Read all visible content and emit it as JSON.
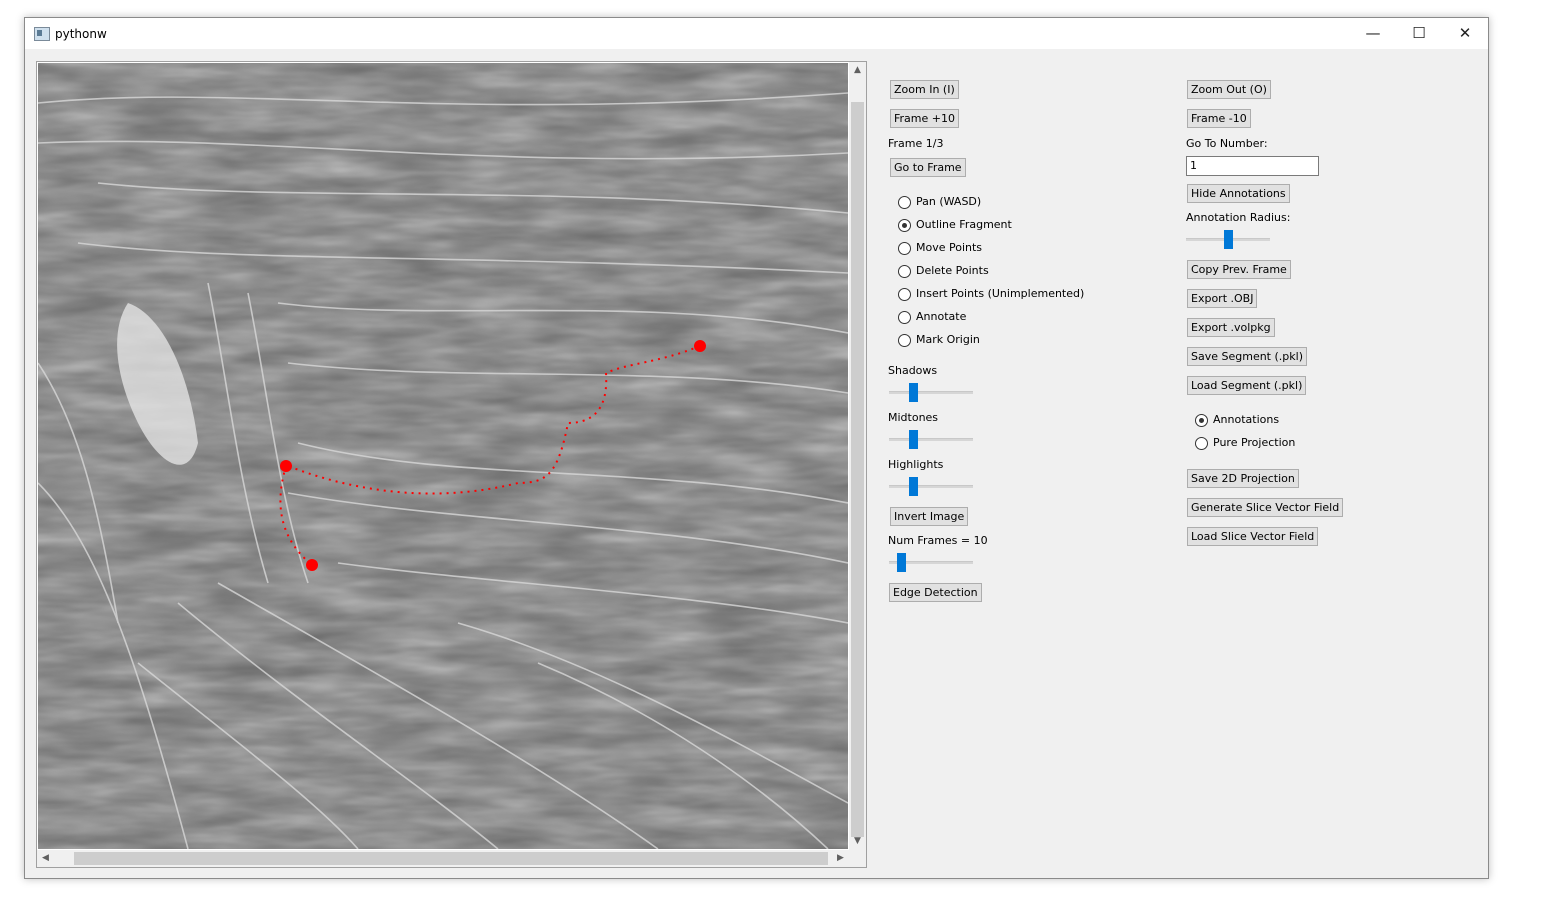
{
  "window": {
    "title": "pythonw"
  },
  "left": {
    "zoom_in": "Zoom In (I)",
    "frame_plus": "Frame +10",
    "frame_label": "Frame 1/3",
    "go_to_frame": "Go to Frame",
    "modes": [
      {
        "label": "Pan (WASD)",
        "checked": false
      },
      {
        "label": "Outline Fragment",
        "checked": true
      },
      {
        "label": "Move Points",
        "checked": false
      },
      {
        "label": "Delete Points",
        "checked": false
      },
      {
        "label": "Insert Points (Unimplemented)",
        "checked": false
      },
      {
        "label": "Annotate",
        "checked": false
      },
      {
        "label": "Mark Origin",
        "checked": false
      }
    ],
    "shadows_label": "Shadows",
    "shadows_value": 0.27,
    "midtones_label": "Midtones",
    "midtones_value": 0.27,
    "highlights_label": "Highlights",
    "highlights_value": 0.27,
    "invert_image": "Invert Image",
    "num_frames_label": "Num Frames = 10",
    "num_frames_value": 0.1,
    "edge_detection": "Edge Detection"
  },
  "right": {
    "zoom_out": "Zoom Out (O)",
    "frame_minus": "Frame -10",
    "go_to_number_label": "Go To Number:",
    "go_to_number_value": "1",
    "hide_annotations": "Hide Annotations",
    "annotation_radius_label": "Annotation Radius:",
    "annotation_radius_value": 0.5,
    "copy_prev_frame": "Copy Prev. Frame",
    "export_obj": "Export .OBJ",
    "export_volpkg": "Export .volpkg",
    "save_segment": "Save Segment (.pkl)",
    "load_segment": "Load Segment (.pkl)",
    "views": [
      {
        "label": "Annotations",
        "checked": true
      },
      {
        "label": "Pure Projection",
        "checked": false
      }
    ],
    "save_2d_projection": "Save 2D Projection",
    "generate_slice_vector_field": "Generate Slice Vector Field",
    "load_slice_vector_field": "Load Slice Vector Field"
  },
  "colors": {
    "annotation_points": "#ff0000",
    "slider_thumb": "#0078d7"
  }
}
